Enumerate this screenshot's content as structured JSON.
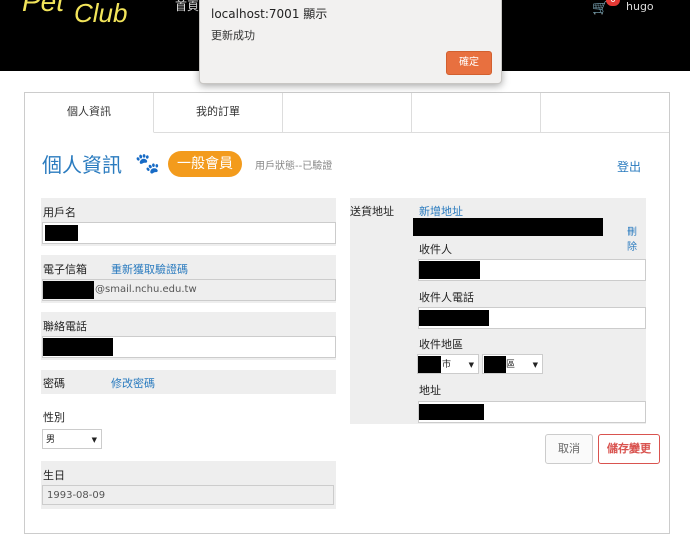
{
  "header": {
    "logo_pet": "Pet",
    "logo_club": "Club",
    "nav_home": "首頁",
    "cart_count": "0",
    "username": "hugo"
  },
  "dialog": {
    "title": "localhost:7001 顯示",
    "message": "更新成功",
    "ok_label": "確定"
  },
  "tabs": [
    "個人資訊",
    "我的訂單",
    "",
    "",
    ""
  ],
  "profile": {
    "title": "個人資訊",
    "member_level": "一般會員",
    "status": "用戶狀態--已驗證",
    "logout": "登出"
  },
  "form": {
    "username_label": "用戶名",
    "email_label": "電子信箱",
    "email_resend": "重新獲取驗證碼",
    "email_suffix": "@smail.nchu.edu.tw",
    "phone_label": "聯絡電話",
    "password_label": "密碼",
    "password_change": "修改密碼",
    "gender_label": "性別",
    "gender_value": "男",
    "birthday_label": "生日",
    "birthday_value": "1993-08-09"
  },
  "shipping": {
    "label": "送貨地址",
    "add_link": "新增地址",
    "delete_link": "刪除",
    "recipient_label": "收件人",
    "recipient_phone_label": "收件人電話",
    "region_label": "收件地區",
    "city_suffix": "市",
    "district_suffix": "區",
    "address_label": "地址"
  },
  "actions": {
    "cancel": "取消",
    "save": "儲存變更"
  },
  "colors": {
    "accent_blue": "#2a7bbf",
    "badge_orange": "#f39b1c",
    "dialog_button": "#e8703f",
    "save_red": "#d9534f"
  }
}
